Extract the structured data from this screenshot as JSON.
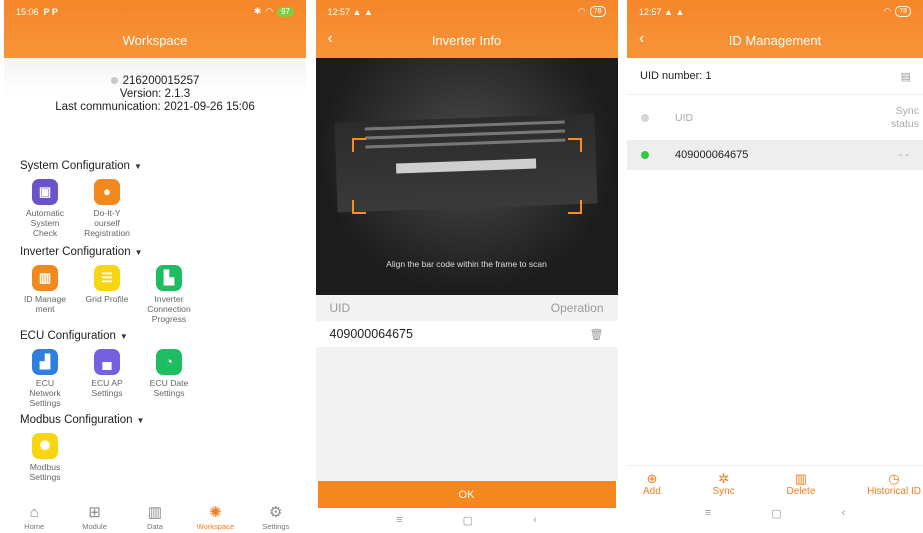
{
  "workspace": {
    "status_time": "15:06",
    "status_left_icons": "P  P",
    "status_battery": "97",
    "title": "Workspace",
    "device_id": "216200015257",
    "version": "Version: 2.1.3",
    "last_communication": "Last communication: 2021-09-26 15:06",
    "system_config": {
      "title": "System Configuration",
      "items": [
        {
          "line1": "Automatic",
          "line2": "System",
          "line3": "Check"
        },
        {
          "line1": "Do-It-Y",
          "line2": "ourself",
          "line3": "Registration"
        }
      ]
    },
    "inverter_config": {
      "title": "Inverter Configuration",
      "items": [
        {
          "line1": "ID Manage",
          "line2": "ment",
          "line3": ""
        },
        {
          "line1": "Grid Profile",
          "line2": "",
          "line3": ""
        },
        {
          "line1": "Inverter",
          "line2": "Connection",
          "line3": "Progress"
        }
      ]
    },
    "ecu_config": {
      "title": "ECU Configuration",
      "items": [
        {
          "line1": "ECU",
          "line2": "Network",
          "line3": "Settings"
        },
        {
          "line1": "ECU AP",
          "line2": "Settings",
          "line3": ""
        },
        {
          "line1": "ECU Date",
          "line2": "Settings",
          "line3": ""
        }
      ]
    },
    "modbus_config": {
      "title": "Modbus Configuration",
      "items": [
        {
          "line1": "Modbus",
          "line2": "Settings",
          "line3": ""
        }
      ]
    },
    "nav": [
      {
        "label": "Home"
      },
      {
        "label": "Module"
      },
      {
        "label": "Data"
      },
      {
        "label": "Workspace"
      },
      {
        "label": "Settings"
      }
    ]
  },
  "inverter_info": {
    "status_time": "12:57",
    "status_battery": "78",
    "title": "Inverter Info",
    "scan_hint": "Align the bar code within the frame to scan",
    "col_uid": "UID",
    "col_operation": "Operation",
    "uid_value": "409000064675",
    "ok_label": "OK"
  },
  "id_management": {
    "status_time": "12:57",
    "status_battery": "78",
    "title": "ID Management",
    "uid_number": "UID number: 1",
    "col_uid": "UID",
    "col_sync_1": "Sync",
    "col_sync_2": "status",
    "row_uid": "409000064675",
    "row_sync": "- -",
    "actions": [
      {
        "label": "Add"
      },
      {
        "label": "Sync"
      },
      {
        "label": "Delete"
      },
      {
        "label": "Historical ID"
      }
    ]
  },
  "colors": {
    "accent": "#f5871f",
    "sync_ok": "#2ecc40"
  }
}
